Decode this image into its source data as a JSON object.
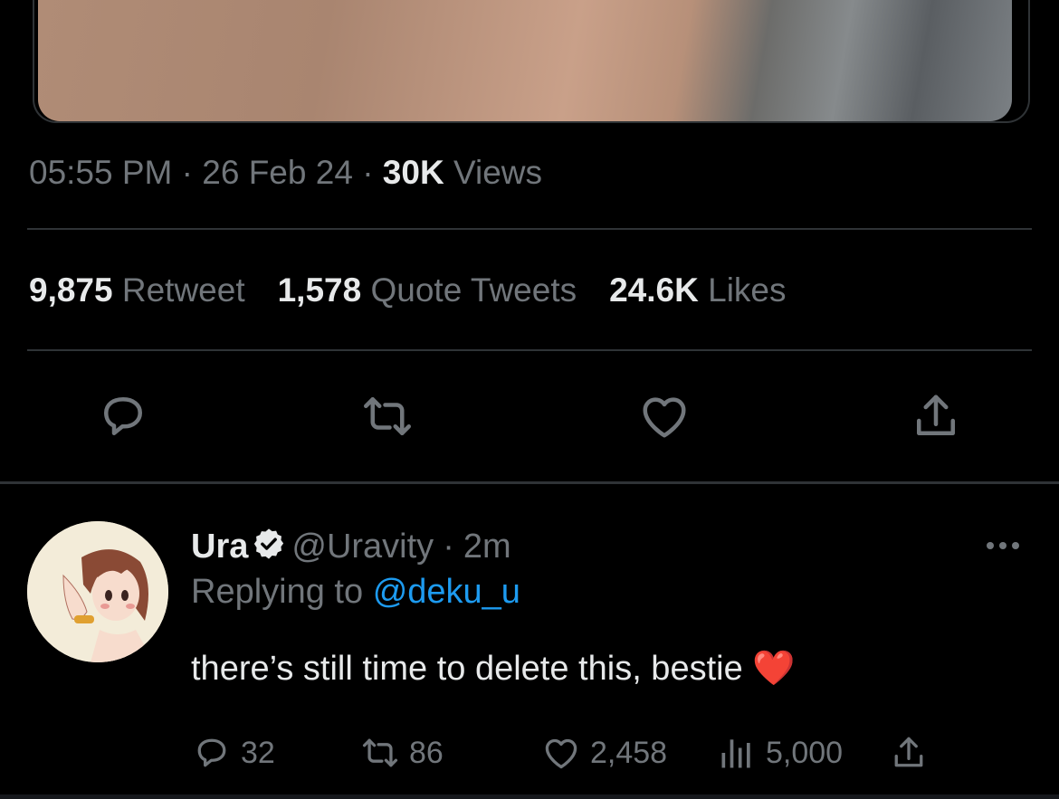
{
  "tweet": {
    "time": "05:55 PM",
    "date": "26 Feb 24",
    "views_count": "30K",
    "views_label": "Views",
    "separator": "·"
  },
  "stats": {
    "retweets_count": "9,875",
    "retweets_label": "Retweet",
    "quotes_count": "1,578",
    "quotes_label": "Quote Tweets",
    "likes_count": "24.6K",
    "likes_label": "Likes"
  },
  "actions": [
    "reply-icon",
    "retweet-icon",
    "like-icon",
    "share-icon"
  ],
  "reply": {
    "name": "Ura",
    "handle": "@Uravity",
    "time": "2m",
    "replying_prefix": "Replying to",
    "replying_to": "@deku_u",
    "text": "there’s still time to delete this, bestie",
    "emoji": "❤️",
    "replies": "32",
    "retweets": "86",
    "likes": "2,458",
    "views": "5,000"
  },
  "colors": {
    "background": "#000000",
    "text_primary": "#e7e9ea",
    "text_secondary": "#71767b",
    "accent": "#1d9bf0",
    "divider": "#2f3336"
  }
}
